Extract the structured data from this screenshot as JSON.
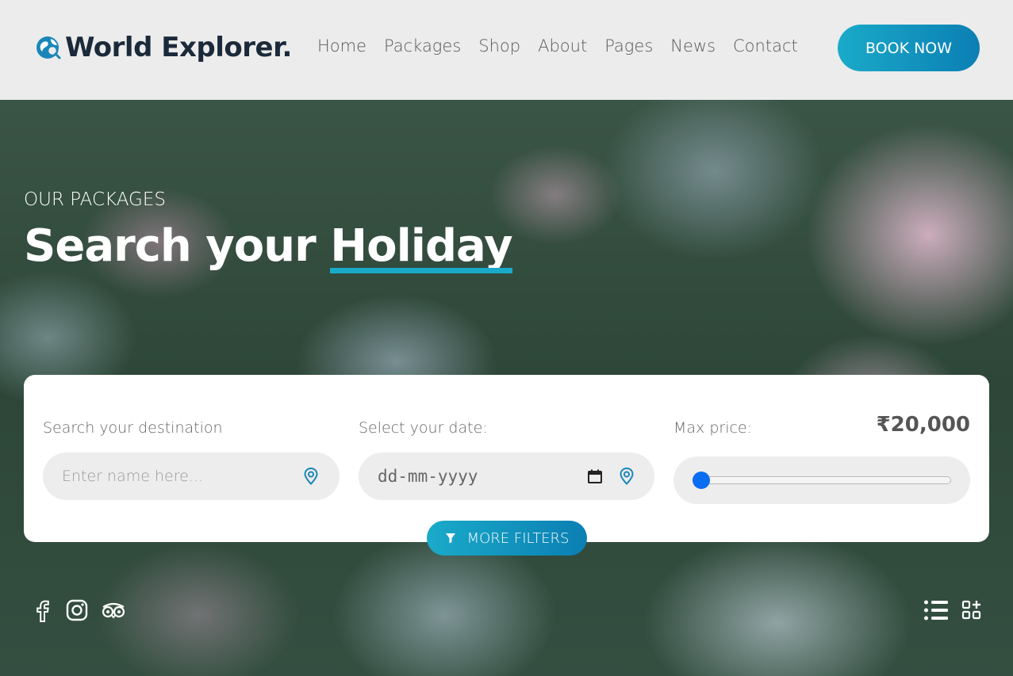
{
  "header": {
    "logo_text": "World Explorer.",
    "nav": [
      "Home",
      "Packages",
      "Shop",
      "About",
      "Pages",
      "News",
      "Contact"
    ],
    "book_button": "BOOK NOW"
  },
  "hero": {
    "subtitle": "OUR PACKAGES",
    "title_plain": "Search your ",
    "title_highlight": "Holiday"
  },
  "search": {
    "destination_label": "Search your destination",
    "destination_placeholder": "Enter name here...",
    "date_label": "Select your date:",
    "date_value": "dd-mm-yyyy",
    "price_label": "Max price:",
    "price_value": "₹20,000",
    "price_slider_fraction": 0.0,
    "more_filters": "MORE FILTERS"
  },
  "colors": {
    "accent": "#1aaac9",
    "accent_dark": "#0b7fb3",
    "logo_text": "#1b2a3a",
    "slider_thumb": "#0a6df2"
  },
  "icons": {
    "logo": "globe-search-icon",
    "pin": "map-pin-icon",
    "calendar": "calendar-icon",
    "filter": "filter-icon",
    "social": [
      "facebook-icon",
      "instagram-icon",
      "tripadvisor-icon"
    ],
    "views": [
      "list-view-icon",
      "grid-view-icon"
    ]
  }
}
